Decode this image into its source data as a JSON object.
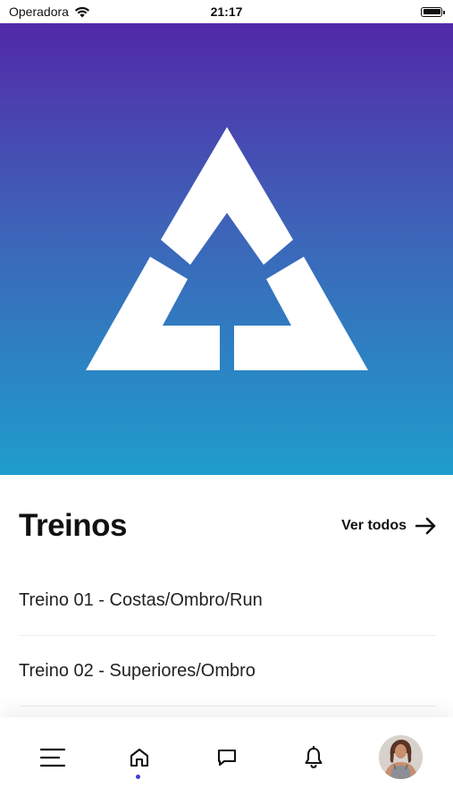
{
  "status_bar": {
    "carrier": "Operadora",
    "time": "21:17"
  },
  "hero": {
    "logo_icon": "triangle-a-logo"
  },
  "section": {
    "title": "Treinos",
    "see_all_label": "Ver todos"
  },
  "workouts": [
    {
      "label": "Treino 01 - Costas/Ombro/Run"
    },
    {
      "label": "Treino 02 - Superiores/Ombro"
    }
  ],
  "bottom_nav": {
    "items": [
      {
        "icon": "menu-icon"
      },
      {
        "icon": "home-icon",
        "active": true
      },
      {
        "icon": "chat-icon"
      },
      {
        "icon": "bell-icon"
      },
      {
        "icon": "avatar"
      }
    ]
  },
  "colors": {
    "gradient_top": "#5229a8",
    "gradient_bottom": "#1e9dcc",
    "active_dot": "#3d3fd6"
  }
}
